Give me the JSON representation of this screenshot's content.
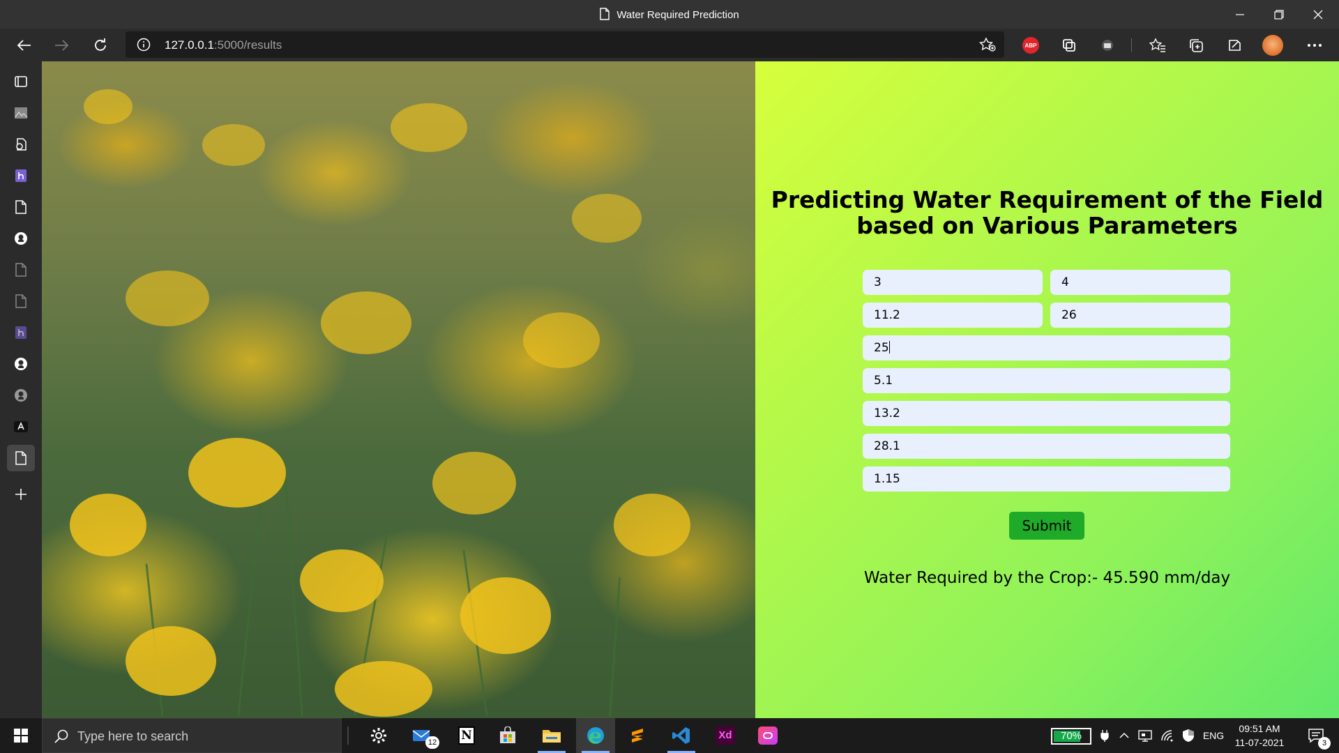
{
  "window": {
    "title": "Water Required Prediction"
  },
  "toolbar": {
    "url_host": "127.0.0.1",
    "url_rest": ":5000/results",
    "extension_abp": "ABP"
  },
  "page": {
    "heading_line1": "Predicting Water Requirement of the Field",
    "heading_line2": "based on Various Parameters",
    "inputs": [
      "3",
      "4",
      "11.2",
      "26",
      "25",
      "5.1",
      "13.2",
      "28.1",
      "1.15"
    ],
    "submit_label": "Submit",
    "result_text": "Water Required by the Crop:- 45.590 mm/day"
  },
  "taskbar": {
    "search_placeholder": "Type here to search",
    "mail_badge": "12",
    "battery_percent": "70%",
    "battery_level": 0.7,
    "language": "ENG",
    "time": "09:51 AM",
    "date": "11-07-2021",
    "notification_count": "3"
  },
  "colors": {
    "panel_gradient_start": "#d6ff3c",
    "panel_gradient_end": "#62e86a",
    "input_bg": "#e8f0fe",
    "submit_bg": "#1faa2a",
    "flower_yellow": "#f0c21c"
  },
  "icons": {
    "sidebar": [
      "tabs-icon",
      "photo-app-icon",
      "tools-icon",
      "heroku-icon",
      "page-icon",
      "github-icon",
      "page-icon",
      "page-icon",
      "heroku-icon",
      "github-icon",
      "github-icon",
      "anaconda-icon",
      "page-icon",
      "add-icon"
    ],
    "taskbar_apps": [
      "settings-icon",
      "mail-icon",
      "notion-icon",
      "store-icon",
      "file-explorer-icon",
      "edge-icon",
      "sublime-text-icon",
      "vscode-icon",
      "adobe-xd-icon",
      "creative-cloud-icon"
    ]
  }
}
